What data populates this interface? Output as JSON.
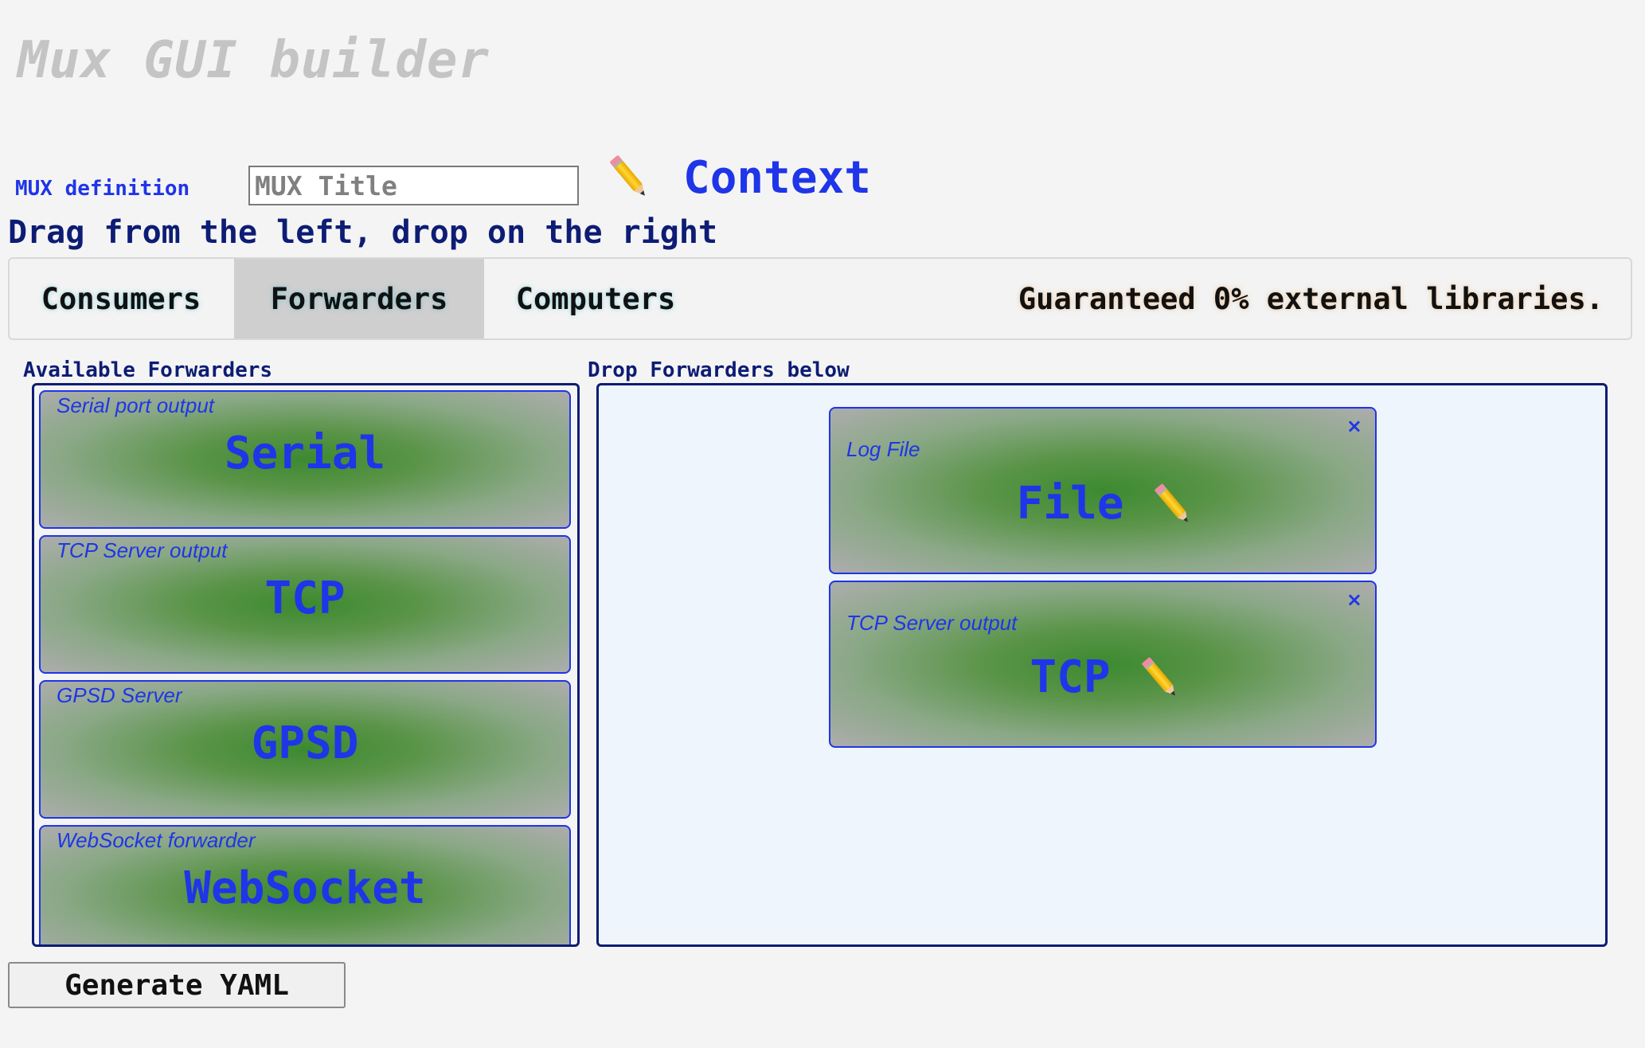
{
  "app": {
    "title": "Mux GUI builder"
  },
  "header": {
    "mux_label": "MUX definition",
    "mux_title_placeholder": "MUX Title",
    "mux_title_value": "",
    "context_label": "Context",
    "instructions": "Drag from the left, drop on the right"
  },
  "tabs": [
    {
      "label": "Consumers",
      "active": false
    },
    {
      "label": "Forwarders",
      "active": true
    },
    {
      "label": "Computers",
      "active": false
    }
  ],
  "tagline": "Guaranteed 0% external libraries.",
  "available": {
    "label": "Available Forwarders",
    "items": [
      {
        "subtitle": "Serial port output",
        "name": "Serial"
      },
      {
        "subtitle": "TCP Server output",
        "name": "TCP"
      },
      {
        "subtitle": "GPSD Server",
        "name": "GPSD"
      },
      {
        "subtitle": "WebSocket forwarder",
        "name": "WebSocket"
      }
    ]
  },
  "dropzone": {
    "label": "Drop Forwarders below",
    "items": [
      {
        "subtitle": "Log File",
        "name": "File",
        "close": "×"
      },
      {
        "subtitle": "TCP Server output",
        "name": "TCP",
        "close": "×"
      }
    ]
  },
  "footer": {
    "generate_label": "Generate YAML"
  },
  "colors": {
    "accent": "#1f35e8",
    "navy": "#0d1c74",
    "title_gray": "#c4c4c4",
    "card_green": "#3c8a30"
  },
  "icons": {
    "edit": "pencil-icon",
    "remove": "close-icon"
  }
}
